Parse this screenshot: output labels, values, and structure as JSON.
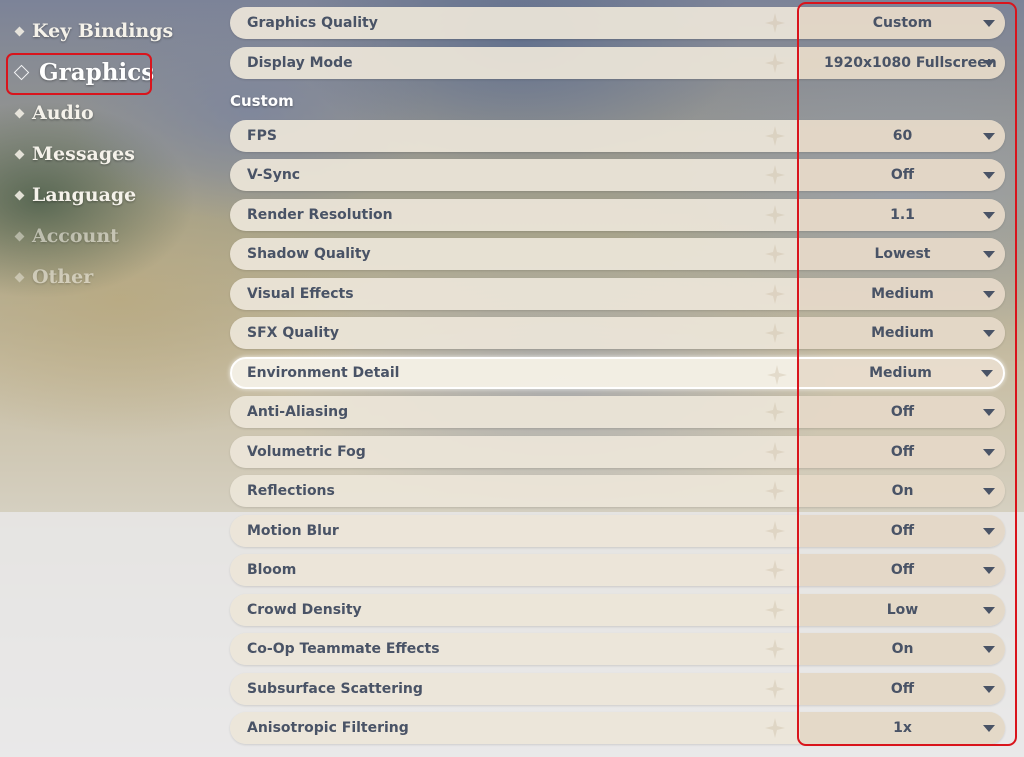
{
  "sidebar": {
    "items": [
      {
        "label": "Key Bindings"
      },
      {
        "label": "Graphics"
      },
      {
        "label": "Audio"
      },
      {
        "label": "Messages"
      },
      {
        "label": "Language"
      },
      {
        "label": "Account"
      },
      {
        "label": "Other"
      }
    ],
    "active": "Graphics"
  },
  "settings": {
    "section_label": "Custom",
    "rows": [
      {
        "label": "Graphics Quality",
        "value": "Custom"
      },
      {
        "label": "Display Mode",
        "value": "1920x1080 Fullscreen"
      },
      {
        "label": "FPS",
        "value": "60"
      },
      {
        "label": "V-Sync",
        "value": "Off"
      },
      {
        "label": "Render Resolution",
        "value": "1.1"
      },
      {
        "label": "Shadow Quality",
        "value": "Lowest"
      },
      {
        "label": "Visual Effects",
        "value": "Medium"
      },
      {
        "label": "SFX Quality",
        "value": "Medium"
      },
      {
        "label": "Environment Detail",
        "value": "Medium"
      },
      {
        "label": "Anti-Aliasing",
        "value": "Off"
      },
      {
        "label": "Volumetric Fog",
        "value": "Off"
      },
      {
        "label": "Reflections",
        "value": "On"
      },
      {
        "label": "Motion Blur",
        "value": "Off"
      },
      {
        "label": "Bloom",
        "value": "Off"
      },
      {
        "label": "Crowd Density",
        "value": "Low"
      },
      {
        "label": "Co-Op Teammate Effects",
        "value": "On"
      },
      {
        "label": "Subsurface Scattering",
        "value": "Off"
      },
      {
        "label": "Anisotropic Filtering",
        "value": "1x"
      }
    ]
  },
  "colors": {
    "highlight": "#d9141c",
    "text": "#495366",
    "row_bg": "#ece5d8"
  }
}
